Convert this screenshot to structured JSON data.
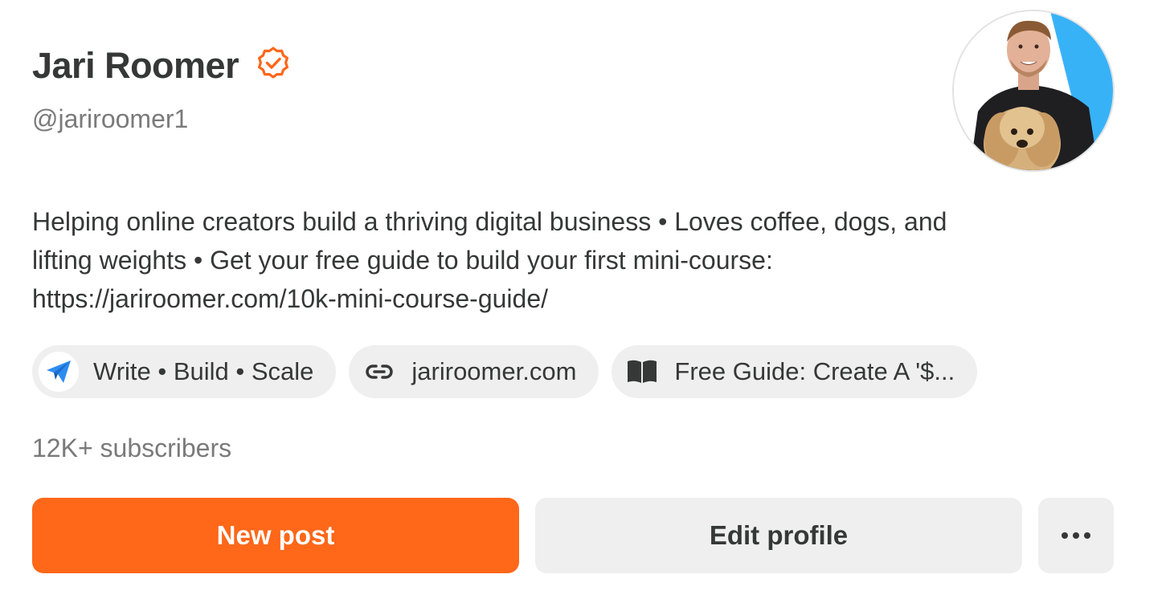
{
  "profile": {
    "name": "Jari Roomer",
    "handle": "@jariroomer1",
    "verified_icon": "verified-badge-icon",
    "avatar_icon": "profile-photo",
    "bio_lines": [
      "Helping online creators build a thriving digital business • Loves coffee, dogs, and",
      "lifting weights • Get your free guide to build your first mini-course:",
      "https://jariroomer.com/10k-mini-course-guide/"
    ],
    "subscribers": "12K+ subscribers"
  },
  "links": [
    {
      "label": "Write • Build • Scale",
      "icon": "paper-plane-icon"
    },
    {
      "label": "jariroomer.com",
      "icon": "link-icon"
    },
    {
      "label": "Free Guide: Create A '$...",
      "icon": "book-icon"
    }
  ],
  "actions": {
    "new_post": "New post",
    "edit_profile": "Edit profile",
    "more": "•••"
  },
  "colors": {
    "accent": "#ff6719",
    "text": "#363737",
    "muted": "#7a7a7a",
    "chip_bg": "#efefef",
    "avatar_bg": "#38b2f7"
  }
}
